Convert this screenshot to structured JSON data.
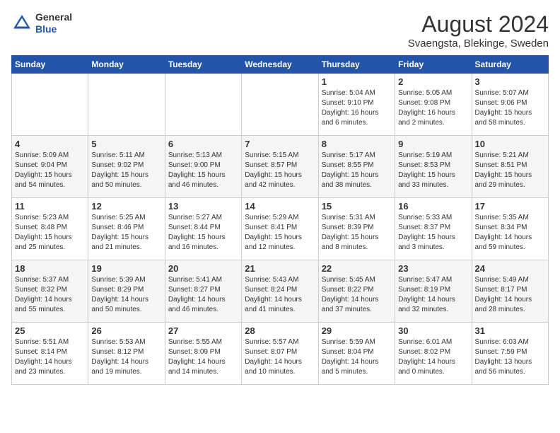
{
  "header": {
    "logo_line1": "General",
    "logo_line2": "Blue",
    "month_year": "August 2024",
    "location": "Svaengsta, Blekinge, Sweden"
  },
  "days_of_week": [
    "Sunday",
    "Monday",
    "Tuesday",
    "Wednesday",
    "Thursday",
    "Friday",
    "Saturday"
  ],
  "weeks": [
    [
      {
        "day": "",
        "info": ""
      },
      {
        "day": "",
        "info": ""
      },
      {
        "day": "",
        "info": ""
      },
      {
        "day": "",
        "info": ""
      },
      {
        "day": "1",
        "info": "Sunrise: 5:04 AM\nSunset: 9:10 PM\nDaylight: 16 hours\nand 6 minutes."
      },
      {
        "day": "2",
        "info": "Sunrise: 5:05 AM\nSunset: 9:08 PM\nDaylight: 16 hours\nand 2 minutes."
      },
      {
        "day": "3",
        "info": "Sunrise: 5:07 AM\nSunset: 9:06 PM\nDaylight: 15 hours\nand 58 minutes."
      }
    ],
    [
      {
        "day": "4",
        "info": "Sunrise: 5:09 AM\nSunset: 9:04 PM\nDaylight: 15 hours\nand 54 minutes."
      },
      {
        "day": "5",
        "info": "Sunrise: 5:11 AM\nSunset: 9:02 PM\nDaylight: 15 hours\nand 50 minutes."
      },
      {
        "day": "6",
        "info": "Sunrise: 5:13 AM\nSunset: 9:00 PM\nDaylight: 15 hours\nand 46 minutes."
      },
      {
        "day": "7",
        "info": "Sunrise: 5:15 AM\nSunset: 8:57 PM\nDaylight: 15 hours\nand 42 minutes."
      },
      {
        "day": "8",
        "info": "Sunrise: 5:17 AM\nSunset: 8:55 PM\nDaylight: 15 hours\nand 38 minutes."
      },
      {
        "day": "9",
        "info": "Sunrise: 5:19 AM\nSunset: 8:53 PM\nDaylight: 15 hours\nand 33 minutes."
      },
      {
        "day": "10",
        "info": "Sunrise: 5:21 AM\nSunset: 8:51 PM\nDaylight: 15 hours\nand 29 minutes."
      }
    ],
    [
      {
        "day": "11",
        "info": "Sunrise: 5:23 AM\nSunset: 8:48 PM\nDaylight: 15 hours\nand 25 minutes."
      },
      {
        "day": "12",
        "info": "Sunrise: 5:25 AM\nSunset: 8:46 PM\nDaylight: 15 hours\nand 21 minutes."
      },
      {
        "day": "13",
        "info": "Sunrise: 5:27 AM\nSunset: 8:44 PM\nDaylight: 15 hours\nand 16 minutes."
      },
      {
        "day": "14",
        "info": "Sunrise: 5:29 AM\nSunset: 8:41 PM\nDaylight: 15 hours\nand 12 minutes."
      },
      {
        "day": "15",
        "info": "Sunrise: 5:31 AM\nSunset: 8:39 PM\nDaylight: 15 hours\nand 8 minutes."
      },
      {
        "day": "16",
        "info": "Sunrise: 5:33 AM\nSunset: 8:37 PM\nDaylight: 15 hours\nand 3 minutes."
      },
      {
        "day": "17",
        "info": "Sunrise: 5:35 AM\nSunset: 8:34 PM\nDaylight: 14 hours\nand 59 minutes."
      }
    ],
    [
      {
        "day": "18",
        "info": "Sunrise: 5:37 AM\nSunset: 8:32 PM\nDaylight: 14 hours\nand 55 minutes."
      },
      {
        "day": "19",
        "info": "Sunrise: 5:39 AM\nSunset: 8:29 PM\nDaylight: 14 hours\nand 50 minutes."
      },
      {
        "day": "20",
        "info": "Sunrise: 5:41 AM\nSunset: 8:27 PM\nDaylight: 14 hours\nand 46 minutes."
      },
      {
        "day": "21",
        "info": "Sunrise: 5:43 AM\nSunset: 8:24 PM\nDaylight: 14 hours\nand 41 minutes."
      },
      {
        "day": "22",
        "info": "Sunrise: 5:45 AM\nSunset: 8:22 PM\nDaylight: 14 hours\nand 37 minutes."
      },
      {
        "day": "23",
        "info": "Sunrise: 5:47 AM\nSunset: 8:19 PM\nDaylight: 14 hours\nand 32 minutes."
      },
      {
        "day": "24",
        "info": "Sunrise: 5:49 AM\nSunset: 8:17 PM\nDaylight: 14 hours\nand 28 minutes."
      }
    ],
    [
      {
        "day": "25",
        "info": "Sunrise: 5:51 AM\nSunset: 8:14 PM\nDaylight: 14 hours\nand 23 minutes."
      },
      {
        "day": "26",
        "info": "Sunrise: 5:53 AM\nSunset: 8:12 PM\nDaylight: 14 hours\nand 19 minutes."
      },
      {
        "day": "27",
        "info": "Sunrise: 5:55 AM\nSunset: 8:09 PM\nDaylight: 14 hours\nand 14 minutes."
      },
      {
        "day": "28",
        "info": "Sunrise: 5:57 AM\nSunset: 8:07 PM\nDaylight: 14 hours\nand 10 minutes."
      },
      {
        "day": "29",
        "info": "Sunrise: 5:59 AM\nSunset: 8:04 PM\nDaylight: 14 hours\nand 5 minutes."
      },
      {
        "day": "30",
        "info": "Sunrise: 6:01 AM\nSunset: 8:02 PM\nDaylight: 14 hours\nand 0 minutes."
      },
      {
        "day": "31",
        "info": "Sunrise: 6:03 AM\nSunset: 7:59 PM\nDaylight: 13 hours\nand 56 minutes."
      }
    ]
  ]
}
